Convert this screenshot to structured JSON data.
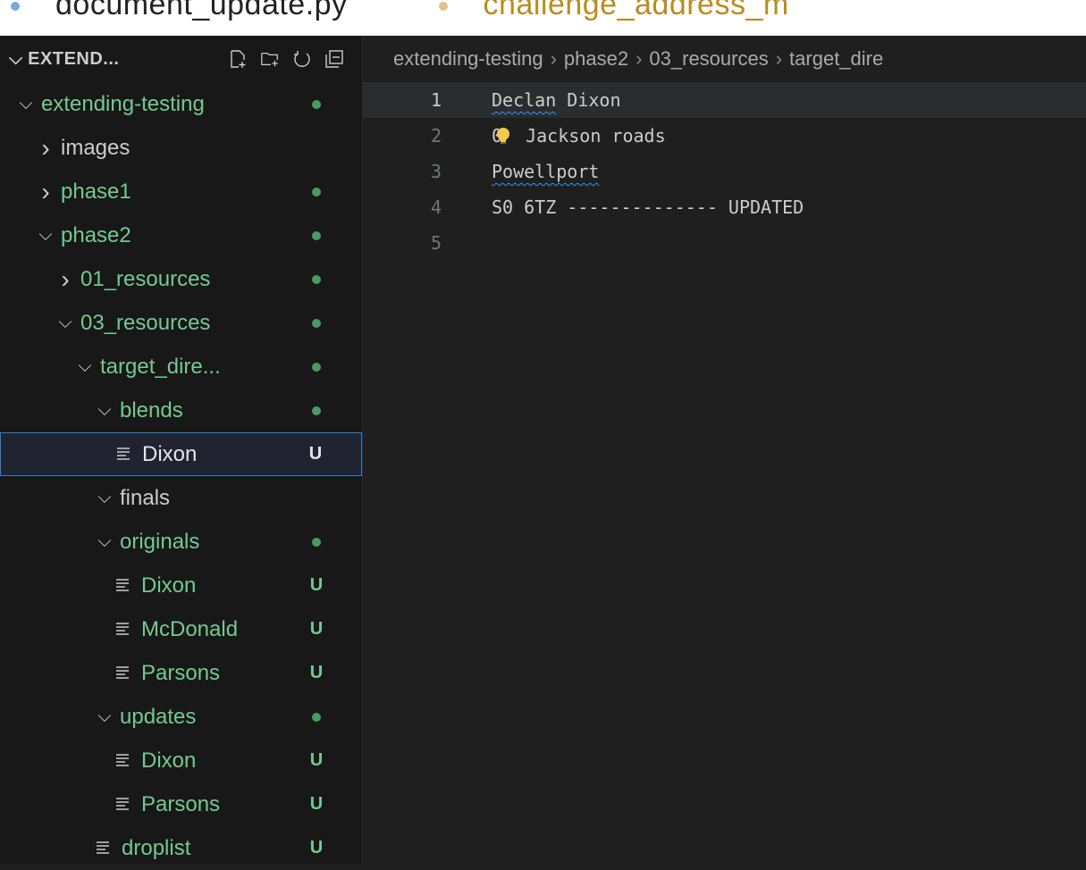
{
  "tabs": {
    "text_1": "document_update.py",
    "text_2": "challenge_address_m"
  },
  "explorer": {
    "title": "EXTEND...",
    "actions": [
      "new-file-icon",
      "new-folder-icon",
      "refresh-icon",
      "collapse-all-icon"
    ]
  },
  "tree": [
    {
      "label": "extending-testing",
      "indent": 0,
      "type": "folder",
      "expanded": true,
      "status": "dot",
      "color": "green"
    },
    {
      "label": "images",
      "indent": 1,
      "type": "folder",
      "expanded": false,
      "status": "",
      "color": "white"
    },
    {
      "label": "phase1",
      "indent": 1,
      "type": "folder",
      "expanded": false,
      "status": "dot",
      "color": "green"
    },
    {
      "label": "phase2",
      "indent": 1,
      "type": "folder",
      "expanded": true,
      "status": "dot",
      "color": "green"
    },
    {
      "label": "01_resources",
      "indent": 2,
      "type": "folder",
      "expanded": false,
      "status": "dot",
      "color": "green"
    },
    {
      "label": "03_resources",
      "indent": 2,
      "type": "folder",
      "expanded": true,
      "status": "dot",
      "color": "green"
    },
    {
      "label": "target_dire...",
      "indent": 3,
      "type": "folder",
      "expanded": true,
      "status": "dot",
      "color": "green"
    },
    {
      "label": "blends",
      "indent": 4,
      "type": "folder",
      "expanded": true,
      "status": "dot",
      "color": "green"
    },
    {
      "label": "Dixon",
      "indent": 5,
      "type": "file",
      "status": "U",
      "color": "white",
      "selected": true
    },
    {
      "label": "finals",
      "indent": 4,
      "type": "folder",
      "expanded": true,
      "status": "",
      "color": "white"
    },
    {
      "label": "originals",
      "indent": 4,
      "type": "folder",
      "expanded": true,
      "status": "dot",
      "color": "green"
    },
    {
      "label": "Dixon",
      "indent": 5,
      "type": "file",
      "status": "U",
      "color": "green"
    },
    {
      "label": "McDonald",
      "indent": 5,
      "type": "file",
      "status": "U",
      "color": "green"
    },
    {
      "label": "Parsons",
      "indent": 5,
      "type": "file",
      "status": "U",
      "color": "green"
    },
    {
      "label": "updates",
      "indent": 4,
      "type": "folder",
      "expanded": true,
      "status": "dot",
      "color": "green"
    },
    {
      "label": "Dixon",
      "indent": 5,
      "type": "file",
      "status": "U",
      "color": "green"
    },
    {
      "label": "Parsons",
      "indent": 5,
      "type": "file",
      "status": "U",
      "color": "green"
    },
    {
      "label": "droplist",
      "indent": 4,
      "type": "file",
      "status": "U",
      "color": "green"
    }
  ],
  "breadcrumb": [
    "extending-testing",
    "phase2",
    "03_resources",
    "target_dire"
  ],
  "editor": {
    "lines": [
      {
        "num": "1",
        "text": "Declan Dixon",
        "squiggle": "Declan",
        "current": true
      },
      {
        "num": "2",
        "text": "0 Jackson roads",
        "lightbulb": true
      },
      {
        "num": "3",
        "text": "Powellport",
        "squiggle": "Powellport"
      },
      {
        "num": "4",
        "text": "S0 6TZ -------------- UPDATED"
      },
      {
        "num": "5",
        "text": ""
      }
    ]
  },
  "colors": {
    "git_untracked": "#73c991",
    "selection_border": "#2f7fd1",
    "squiggle": "#3794ff"
  }
}
